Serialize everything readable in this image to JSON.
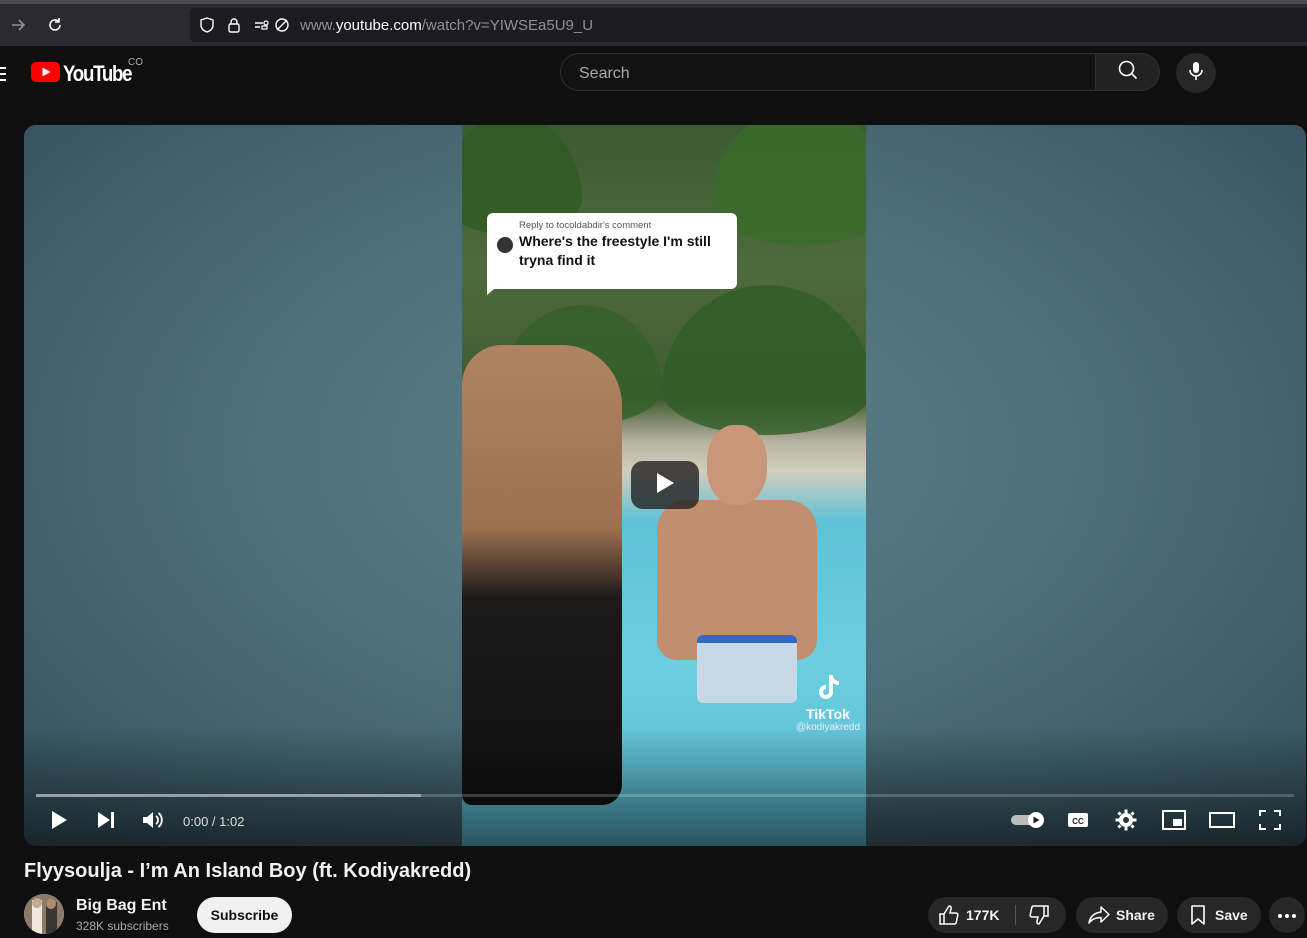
{
  "browser": {
    "url_prefix": "www.",
    "url_domain": "youtube.com",
    "url_path": "/watch?v=YIWSEa5U9_U",
    "icons": [
      "forward-arrow-icon",
      "reload-icon",
      "shield-icon",
      "lock-icon",
      "permissions-icon",
      "camera-off-icon"
    ]
  },
  "masthead": {
    "logo_text": "YouTube",
    "country_code": "CO",
    "search_placeholder": "Search",
    "icons": [
      "menu-icon",
      "youtube-play-logo-icon",
      "search-icon",
      "microphone-icon"
    ]
  },
  "player": {
    "overlay_comment": {
      "reply_to": "Reply to tocoldabdir's comment",
      "text": "Where's the freestyle I'm still tryna find it"
    },
    "watermark": {
      "brand": "TikTok",
      "user": "@kodiyakredd"
    },
    "current_time": "0:00",
    "duration": "1:02",
    "time_display": "0:00 / 1:02",
    "buffered_fraction": 0.306,
    "icons": [
      "play-icon",
      "next-icon",
      "volume-icon",
      "autoplay-toggle-icon",
      "captions-icon",
      "settings-gear-icon",
      "miniplayer-icon",
      "theater-mode-icon",
      "fullscreen-icon",
      "big-play-icon"
    ]
  },
  "video": {
    "title": "Flyysoulja - I’m An Island Boy (ft. Kodiyakredd)",
    "channel_name": "Big Bag Ent",
    "subscribers": "328K subscribers",
    "subscribe_label": "Subscribe",
    "likes": "177K",
    "share_label": "Share",
    "save_label": "Save"
  },
  "colors": {
    "page_bg": "#0f0f0f",
    "youtube_red": "#ff0000",
    "pill_bg": "#272727",
    "subscribe_bg": "#f1f1f1"
  }
}
